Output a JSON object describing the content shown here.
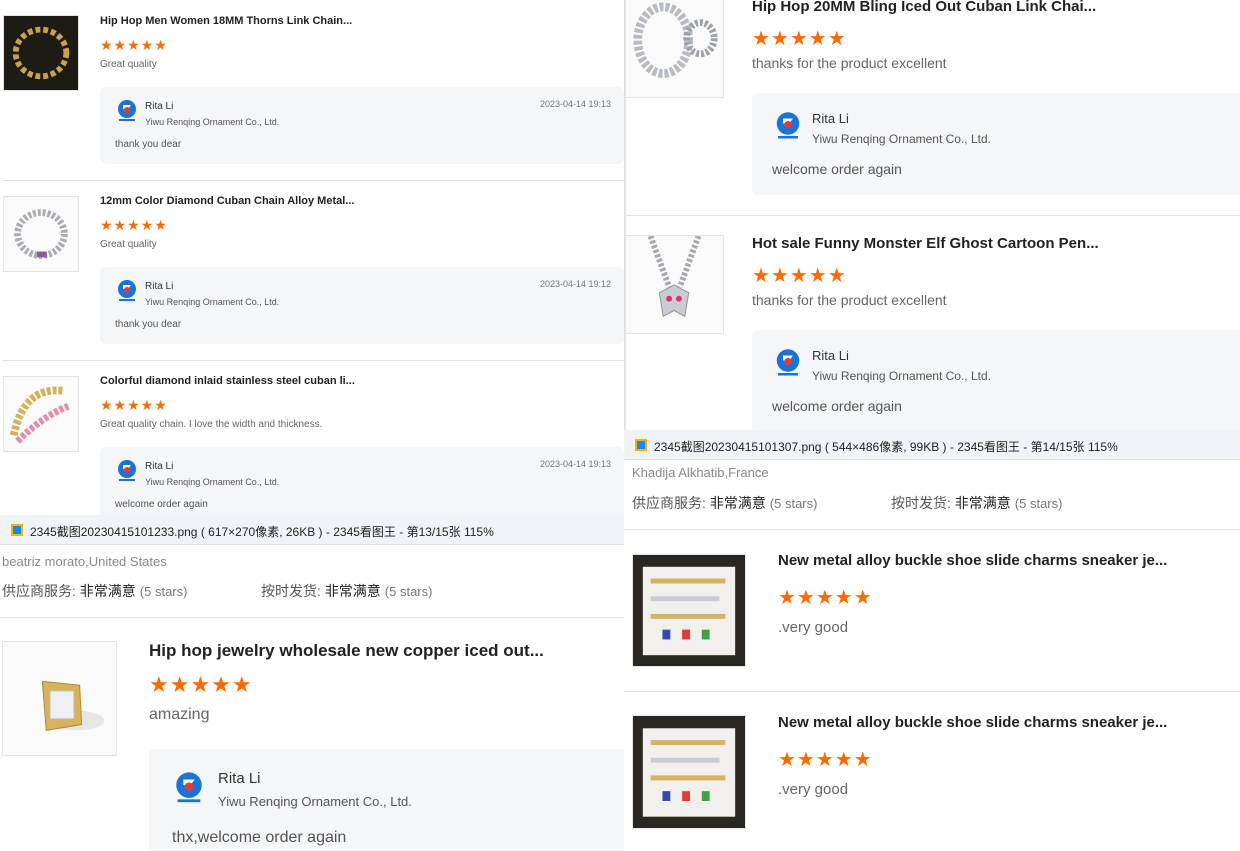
{
  "colors": {
    "star": "#ff6a00",
    "reply_bg": "#f5f6f8",
    "divider": "#e2e2e2"
  },
  "star_text": "★★★★★",
  "panel_tl": {
    "items": [
      {
        "title": "Hip Hop Men Women 18MM Thorns Link Chain...",
        "rating": 5,
        "review": "Great quality",
        "reply": {
          "name": "Rita Li",
          "company": "Yiwu Renqing Ornament Co., Ltd.",
          "date": "2023-04-14 19:13",
          "message": "thank you dear"
        }
      },
      {
        "title": "12mm Color Diamond Cuban Chain Alloy Metal...",
        "rating": 5,
        "review": "Great quality",
        "reply": {
          "name": "Rita Li",
          "company": "Yiwu Renqing Ornament Co., Ltd.",
          "date": "2023-04-14 19:12",
          "message": "thank you dear"
        }
      },
      {
        "title": "Colorful diamond inlaid stainless steel cuban li...",
        "rating": 5,
        "review": "Great quality chain. I love the width and thickness.",
        "reply": {
          "name": "Rita Li",
          "company": "Yiwu Renqing Ornament Co., Ltd.",
          "date": "2023-04-14 19:13",
          "message": "welcome order again"
        }
      }
    ]
  },
  "panel_tr": {
    "items": [
      {
        "title": "Hip Hop 20MM Bling Iced Out Cuban Link Chai...",
        "rating": 5,
        "review": "thanks for the product excellent",
        "reply": {
          "name": "Rita Li",
          "company": "Yiwu Renqing Ornament Co., Ltd.",
          "message": "welcome order again"
        }
      },
      {
        "title": "Hot sale Funny Monster Elf Ghost Cartoon Pen...",
        "rating": 5,
        "review": "thanks for the product excellent",
        "reply": {
          "name": "Rita Li",
          "company": "Yiwu Renqing Ornament Co., Ltd.",
          "message": "welcome order again"
        }
      }
    ]
  },
  "panel_bl": {
    "window_title": "2345截图20230415101233.png ( 617×270像素, 26KB ) - 2345看图王 - 第13/15张 115%",
    "buyer": "beatriz morato,United States",
    "ratings": [
      {
        "label": "供应商服务:",
        "value": "非常满意",
        "count": "(5 stars)"
      },
      {
        "label": "按时发货:",
        "value": "非常满意",
        "count": "(5 stars)"
      }
    ],
    "item": {
      "title": "Hip hop jewelry wholesale new copper iced out...",
      "rating": 5,
      "review": "amazing",
      "reply": {
        "name": "Rita Li",
        "company": "Yiwu Renqing Ornament Co., Ltd.",
        "message": "thx,welcome order again"
      }
    }
  },
  "panel_br": {
    "window_title": "2345截图20230415101307.png ( 544×486像素, 99KB ) - 2345看图王 - 第14/15张 115%",
    "buyer": "Khadija Alkhatib,France",
    "ratings": [
      {
        "label": "供应商服务:",
        "value": "非常满意",
        "count": "(5 stars)"
      },
      {
        "label": "按时发货:",
        "value": "非常满意",
        "count": "(5 stars)"
      }
    ],
    "items": [
      {
        "title": "New metal alloy buckle shoe slide charms sneaker je...",
        "rating": 5,
        "review": ".very good"
      },
      {
        "title": "New metal alloy buckle shoe slide charms sneaker je...",
        "rating": 5,
        "review": ".very good"
      }
    ]
  }
}
